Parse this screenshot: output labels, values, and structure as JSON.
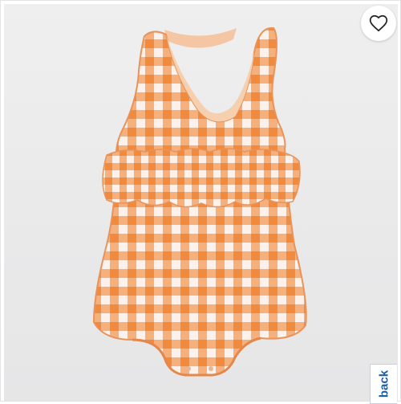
{
  "product_image": {
    "alt": "",
    "pattern_colors": {
      "base": "#f8d2b4",
      "stripe": "#f5a569",
      "cross": "#f08a3e",
      "light": "#fdf1ea"
    }
  },
  "favorite_button": {
    "icon": "heart-outline-icon",
    "state": "not-favorited"
  },
  "feedback_tab": {
    "label": "back"
  }
}
